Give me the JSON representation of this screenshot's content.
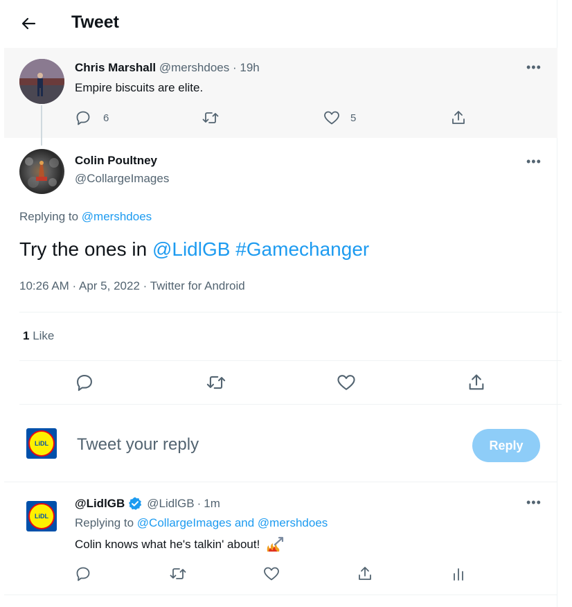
{
  "header": {
    "title": "Tweet"
  },
  "parent_tweet": {
    "author_name": "Chris Marshall",
    "handle": "@mershdoes",
    "sep": "·",
    "time": "19h",
    "text": "Empire biscuits are elite.",
    "reply_count": "6",
    "like_count": "5"
  },
  "main_tweet": {
    "author_name": "Colin Poultney",
    "handle": "@CollargeImages",
    "replying_label": "Replying to",
    "replying_handle": "@mershdoes",
    "text_plain": "Try the ones in ",
    "mention": "@LidlGB",
    "space": " ",
    "hashtag": "#Gamechanger",
    "timestamp": "10:26 AM · Apr 5, 2022 · Twitter for Android",
    "likes_number": "1",
    "likes_label": "Like"
  },
  "compose": {
    "placeholder": "Tweet your reply",
    "reply_button": "Reply",
    "avatar_text": "LiDL"
  },
  "reply_tweet": {
    "author_name": "@LidlGB",
    "handle": "@LidlGB",
    "sep": "·",
    "time": "1m",
    "replying_label": "Replying to",
    "replying_handles": "@CollargeImages and @mershdoes",
    "text": "Colin knows what he's talkin' about!",
    "avatar_text": "LiDL"
  },
  "colors": {
    "accent": "#1d9bf0",
    "muted": "#536471",
    "reply_button_disabled": "#8ecdf8",
    "highlight_bg": "#f7f7f7"
  }
}
